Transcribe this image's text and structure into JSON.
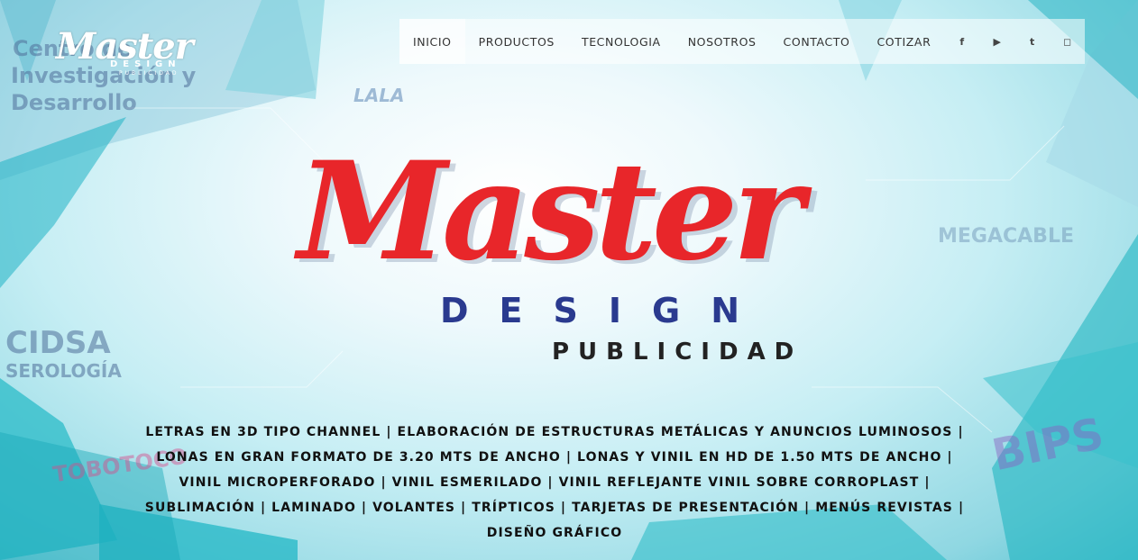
{
  "header": {
    "logo_alt": "Master Design Publicidad"
  },
  "nav": {
    "items": [
      {
        "label": "INICIO",
        "active": true
      },
      {
        "label": "PRODUCTOS"
      },
      {
        "label": "TECNOLOGIA"
      },
      {
        "label": "NOSOTROS"
      },
      {
        "label": "CONTACTO"
      },
      {
        "label": "COTIZAR"
      }
    ],
    "social": [
      {
        "icon": "facebook-icon",
        "glyph": "f"
      },
      {
        "icon": "youtube-icon",
        "glyph": "▶"
      },
      {
        "icon": "twitter-icon",
        "glyph": "t"
      },
      {
        "icon": "instagram-icon",
        "glyph": "◻"
      }
    ]
  },
  "hero": {
    "logo_word": "Master",
    "logo_sub": "DESIGN",
    "logo_sub2": "PUBLICIDAD",
    "services_text": "LETRAS EN 3D TIPO CHANNEL | ELABORACIÓN DE ESTRUCTURAS METÁLICAS Y ANUNCIOS LUMINOSOS | LONAS EN GRAN FORMATO DE 3.20 MTS DE ANCHO | LONAS Y VINIL EN HD DE 1.50 MTS DE ANCHO | VINIL MICROPERFORADO | VINIL ESMERILADO | VINIL REFLEJANTE VINIL SOBRE CORROPLAST | SUBLIMACIÓN | LAMINADO | VOLANTES | TRÍPTICOS | TARJETAS DE PRESENTACIÓN | MENÚS REVISTAS | DISEÑO GRÁFICO"
  },
  "background_signs": {
    "line1": "Centro de",
    "line2": "Investigación y",
    "line3": "Desarrollo",
    "lala": "LALA",
    "cidsa": "CIDSA",
    "serologia": "SEROLOGÍA",
    "megacable": "MEGACABLE",
    "tobotoco": "TOBOTOCO",
    "bips": "BIPS"
  },
  "colors": {
    "brand_red": "#e8262a",
    "brand_navy": "#2a3a8f",
    "teal": "#20bfc9"
  }
}
